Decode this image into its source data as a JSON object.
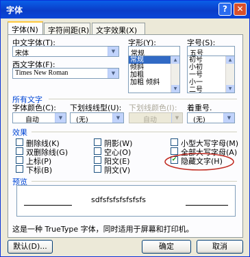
{
  "window": {
    "title": "字体"
  },
  "tabs": [
    {
      "label": "字体(N)"
    },
    {
      "label": "字符间距(R)"
    },
    {
      "label": "文字效果(X)"
    }
  ],
  "font": {
    "cn_label": "中文字体(T):",
    "cn_value": "宋体",
    "west_label": "西文字体(F):",
    "west_value": "Times New Roman",
    "style_label": "字形(Y):",
    "style_value": "常规",
    "style_options": [
      "常规",
      "倾斜",
      "加粗",
      "加粗 倾斜"
    ],
    "size_label": "字号(S):",
    "size_value": "五号",
    "size_options": [
      "初号",
      "小初",
      "一号",
      "小一",
      "二号"
    ]
  },
  "all_text": {
    "section": "所有文字",
    "color_label": "字体颜色(C):",
    "color_value": "自动",
    "underline_label": "下划线线型(U):",
    "underline_value": "(无)",
    "underline_color_label": "下划线颜色(I):",
    "underline_color_value": "自动",
    "emphasis_label": "着重号.",
    "emphasis_value": "(无)"
  },
  "effects": {
    "section": "效果",
    "items": [
      {
        "label": "删除线(K)",
        "checked": false
      },
      {
        "label": "双删除线(G)",
        "checked": false
      },
      {
        "label": "上标(P)",
        "checked": false
      },
      {
        "label": "下标(B)",
        "checked": false
      },
      {
        "label": "阴影(W)",
        "checked": false
      },
      {
        "label": "空心(O)",
        "checked": false
      },
      {
        "label": "阳文(E)",
        "checked": false
      },
      {
        "label": "阴文(V)",
        "checked": false
      },
      {
        "label": "小型大写字母(M)",
        "checked": false
      },
      {
        "label": "全部大写字母(A)",
        "checked": false
      },
      {
        "label": "隐藏文字(H)",
        "checked": true
      }
    ]
  },
  "preview": {
    "section": "预览",
    "sample": "sdfsfsfsfsfsfsfs",
    "note": "这是一种 TrueType 字体，同时适用于屏幕和打印机。"
  },
  "buttons": {
    "default": "默认(D)...",
    "ok": "确定",
    "cancel": "取消"
  },
  "colors": {
    "highlight_circle": "#C0281E",
    "title_bar": "#0A46D8"
  }
}
